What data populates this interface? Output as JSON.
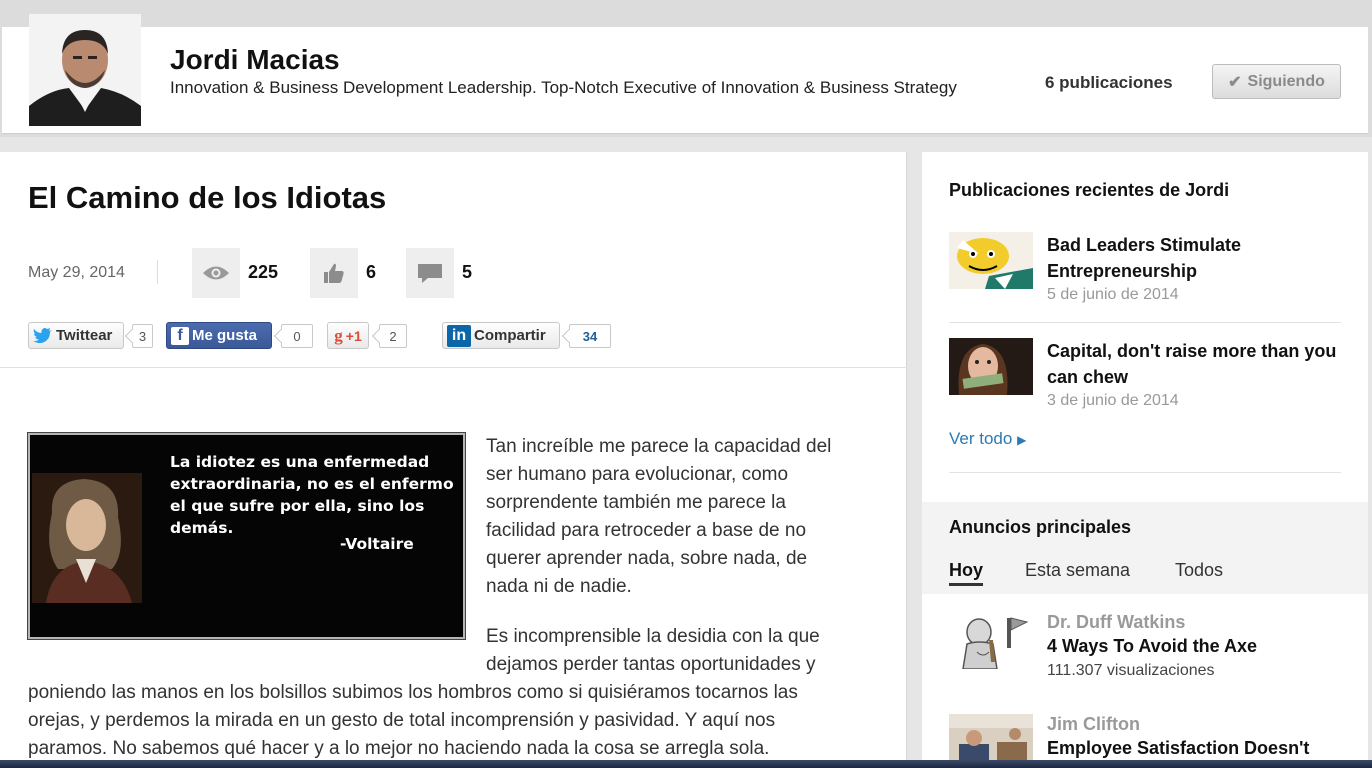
{
  "author": {
    "name": "Jordi Macias",
    "headline": "Innovation & Business Development Leadership. Top-Notch Executive of Innovation & Business Strategy",
    "publications": "6 publicaciones",
    "follow_label": "Siguiendo"
  },
  "article": {
    "title": "El Camino de los Idiotas",
    "date": "May 29, 2014",
    "views": "225",
    "likes": "6",
    "comments": "5",
    "share": {
      "twitter_label": "Twittear",
      "twitter_count": "3",
      "facebook_label": "Me gusta",
      "facebook_count": "0",
      "gplus_label": "+1",
      "gplus_count": "2",
      "linkedin_label": "Compartir",
      "linkedin_count": "34"
    },
    "image_quote": {
      "text": "La idiotez es una enfermedad extraordinaria, no es el enfermo el que sufre por ella, sino los demás.",
      "author": "-Voltaire"
    },
    "paragraph1_lines": [
      "Tan increíble me parece la capacidad del",
      "ser humano para evolucionar, como",
      "sorprendente también me parece la",
      "facilidad para retroceder a base de no",
      "querer aprender nada, sobre nada, de",
      "nada ni de nadie."
    ],
    "paragraph2_lines": [
      "Es incomprensible la desidia con la que",
      "dejamos perder tantas oportunidades y",
      "poniendo las manos en los bolsillos subimos los hombros como si quisiéramos tocarnos las",
      "orejas, y perdemos la mirada en un gesto de total incomprensión y pasividad. Y aquí nos",
      "paramos. No sabemos qué hacer y a lo mejor no haciendo nada la cosa se arregla sola."
    ]
  },
  "sidebar": {
    "recent_title": "Publicaciones recientes de Jordi",
    "recent": [
      {
        "title": "Bad Leaders Stimulate Entrepreneurship",
        "date": "5 de junio de 2014"
      },
      {
        "title": "Capital, don't raise more than you can chew",
        "date": "3 de junio de 2014"
      }
    ],
    "see_all": "Ver todo",
    "ads_title": "Anuncios principales",
    "tabs": [
      "Hoy",
      "Esta semana",
      "Todos"
    ],
    "ads": [
      {
        "author": "Dr. Duff Watkins",
        "title": "4 Ways To Avoid the Axe",
        "views": "111.307 visualizaciones"
      },
      {
        "author": "Jim Clifton",
        "title": "Employee Satisfaction Doesn't"
      }
    ]
  },
  "colors": {
    "link_blue": "#2a7ab5",
    "facebook": "#3b5998",
    "gplus": "#dd4b39",
    "linkedin": "#0a66a8",
    "twitter": "#2aa3ef"
  }
}
